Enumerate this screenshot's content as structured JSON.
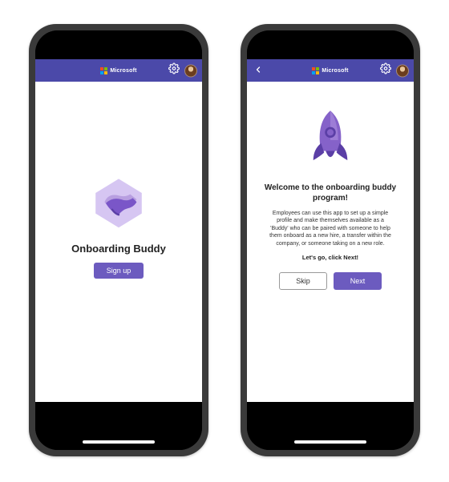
{
  "brand": "Microsoft",
  "header": {
    "accent": "#4b49a9",
    "gear": "settings-icon",
    "avatar": "user-avatar"
  },
  "screen1": {
    "title": "Onboarding Buddy",
    "signup_label": "Sign up",
    "icon": "handshake-icon"
  },
  "screen2": {
    "back": "back-icon",
    "icon": "rocket-icon",
    "welcome_title": "Welcome to the onboarding buddy program!",
    "welcome_desc": "Employees can use this app to set up a simple profile and make themselves available as a 'Buddy' who can be paired with someone to help them onboard as a new hire, a transfer within the company, or someone taking on a new role.",
    "welcome_cta": "Let's go, click Next!",
    "skip_label": "Skip",
    "next_label": "Next"
  },
  "colors": {
    "primary_button": "#6c5bbf",
    "rocket_body": "#8562c9",
    "rocket_dark": "#5b3fa6",
    "handshake_light": "#b89fe0",
    "handshake_dark": "#7a56c8"
  }
}
